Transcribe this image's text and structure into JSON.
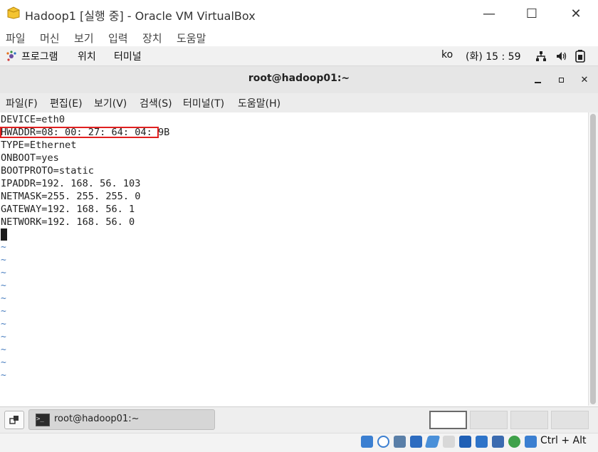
{
  "window": {
    "title": "Hadoop1 [실행 중] - Oracle VM VirtualBox",
    "minimize_glyph": "—",
    "maximize_glyph": "☐",
    "close_glyph": "✕"
  },
  "vb_menu": [
    "파일",
    "머신",
    "보기",
    "입력",
    "장치",
    "도움말"
  ],
  "guest_panel": {
    "programs": "프로그램",
    "places": "위치",
    "terminal": "터미널",
    "input_method": "ko",
    "clock": "(화) 15 : 59"
  },
  "terminal": {
    "title": "root@hadoop01:~",
    "menu": [
      "파일(F)",
      "편집(E)",
      "보기(V)",
      "검색(S)",
      "터미널(T)",
      "도움말(H)"
    ],
    "lines": [
      "DEVICE=eth0",
      "HWADDR=08: 00: 27: 64: 04: 9B",
      "TYPE=Ethernet",
      "ONBOOT=yes",
      "BOOTPROTO=static",
      "IPADDR=192. 168. 56. 103",
      "NETMASK=255. 255. 255. 0",
      "GATEWAY=192. 168. 56. 1",
      "NETWORK=192. 168. 56. 0"
    ],
    "tilde": "~"
  },
  "taskbar": {
    "item_label": "root@hadoop01:~"
  },
  "statusbar": {
    "host_key": "Ctrl + Alt"
  },
  "colors": {
    "highlight_border": "#e02020",
    "tilde": "#4a7fc0"
  }
}
